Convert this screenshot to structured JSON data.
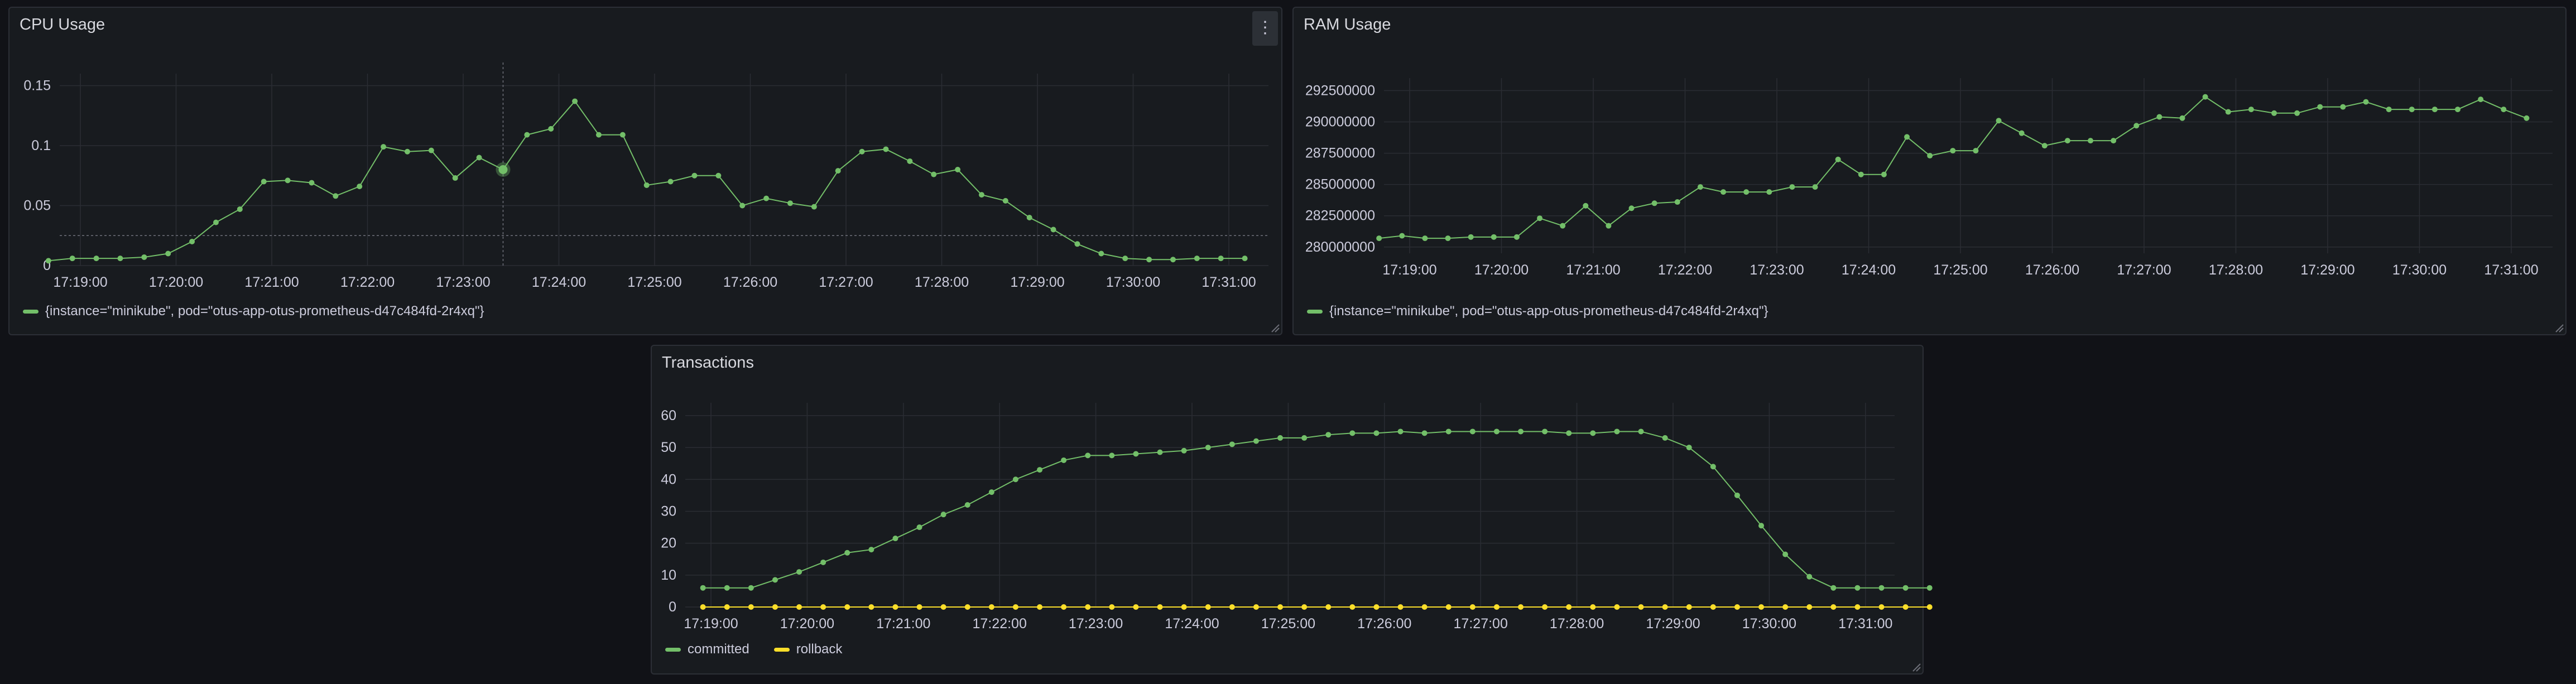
{
  "colors": {
    "series_green": "#73bf69",
    "series_yellow": "#fade2a",
    "grid": "#2a2d33",
    "crosshair": "#6e7079"
  },
  "panels": {
    "cpu": {
      "title": "CPU Usage",
      "menu_icon": "kebab-menu-icon",
      "menu_glyph": "⋮"
    },
    "ram": {
      "title": "RAM Usage"
    },
    "tx": {
      "title": "Transactions"
    }
  },
  "chart_data": [
    {
      "id": "cpu",
      "type": "line",
      "title": "CPU Usage",
      "x_tick_labels": [
        "17:19:00",
        "17:20:00",
        "17:21:00",
        "17:22:00",
        "17:23:00",
        "17:24:00",
        "17:25:00",
        "17:26:00",
        "17:27:00",
        "17:28:00",
        "17:29:00",
        "17:30:00",
        "17:31:00"
      ],
      "y_tick_labels": [
        "0",
        "0.05",
        "0.1",
        "0.15"
      ],
      "ylim": [
        0,
        0.16
      ],
      "x_start": "17:18:40",
      "x_step_seconds": 15,
      "series": [
        {
          "name": "{instance=\"minikube\", pod=\"otus-app-otus-prometheus-d47c484fd-2r4xq\"}",
          "color": "#73bf69",
          "values": [
            0.004,
            0.006,
            0.006,
            0.006,
            0.007,
            0.01,
            0.02,
            0.036,
            0.047,
            0.07,
            0.071,
            0.069,
            0.058,
            0.066,
            0.099,
            0.095,
            0.096,
            0.073,
            0.09,
            0.08,
            0.109,
            0.114,
            0.137,
            0.109,
            0.109,
            0.067,
            0.07,
            0.075,
            0.075,
            0.05,
            0.056,
            0.052,
            0.049,
            0.079,
            0.095,
            0.097,
            0.087,
            0.076,
            0.08,
            0.059,
            0.054,
            0.04,
            0.03,
            0.018,
            0.01,
            0.006,
            0.005,
            0.005,
            0.006,
            0.006,
            0.006
          ]
        }
      ],
      "hover_point_index": 19,
      "legend_placement": "bottom-left",
      "grid": true
    },
    {
      "id": "ram",
      "type": "line",
      "title": "RAM Usage",
      "x_tick_labels": [
        "17:19:00",
        "17:20:00",
        "17:21:00",
        "17:22:00",
        "17:23:00",
        "17:24:00",
        "17:25:00",
        "17:26:00",
        "17:27:00",
        "17:28:00",
        "17:29:00",
        "17:30:00",
        "17:31:00"
      ],
      "y_tick_labels": [
        "280000000",
        "282500000",
        "285000000",
        "287500000",
        "290000000",
        "292500000"
      ],
      "ylim": [
        279500000,
        293500000
      ],
      "x_start": "17:18:40",
      "x_step_seconds": 15,
      "series": [
        {
          "name": "{instance=\"minikube\", pod=\"otus-app-otus-prometheus-d47c484fd-2r4xq\"}",
          "color": "#73bf69",
          "values": [
            280700000,
            280900000,
            280700000,
            280700000,
            280800000,
            280800000,
            280800000,
            282300000,
            281700000,
            283300000,
            281700000,
            283100000,
            283500000,
            283600000,
            284800000,
            284400000,
            284400000,
            284400000,
            284800000,
            284800000,
            287000000,
            285800000,
            285800000,
            288800000,
            287300000,
            287700000,
            287700000,
            290100000,
            289100000,
            288100000,
            288500000,
            288500000,
            288500000,
            289700000,
            290400000,
            290300000,
            292000000,
            290800000,
            291000000,
            290700000,
            290700000,
            291200000,
            291200000,
            291600000,
            291000000,
            291000000,
            291000000,
            291000000,
            291800000,
            291000000,
            290300000
          ]
        }
      ],
      "legend_placement": "bottom-left",
      "grid": true
    },
    {
      "id": "tx",
      "type": "line",
      "title": "Transactions",
      "x_tick_labels": [
        "17:19:00",
        "17:20:00",
        "17:21:00",
        "17:22:00",
        "17:23:00",
        "17:24:00",
        "17:25:00",
        "17:26:00",
        "17:27:00",
        "17:28:00",
        "17:29:00",
        "17:30:00",
        "17:31:00"
      ],
      "y_tick_labels": [
        "0",
        "10",
        "20",
        "30",
        "40",
        "50",
        "60"
      ],
      "ylim": [
        0,
        64
      ],
      "x_start": "17:18:55",
      "x_step_seconds": 15,
      "series": [
        {
          "name": "committed",
          "color": "#73bf69",
          "values": [
            6,
            6,
            6,
            8.5,
            11,
            14,
            17,
            18,
            21.5,
            25,
            29,
            32,
            36,
            40,
            43,
            46,
            47.5,
            47.5,
            48,
            48.5,
            49,
            50,
            51,
            52,
            53,
            53,
            54,
            54.5,
            54.5,
            55,
            54.5,
            55,
            55,
            55,
            55,
            55,
            54.5,
            54.5,
            55,
            55,
            53,
            50,
            44,
            35,
            25.5,
            16.5,
            9.5,
            6,
            6,
            6,
            6,
            6
          ]
        },
        {
          "name": "rollback",
          "color": "#fade2a",
          "values": [
            0,
            0,
            0,
            0,
            0,
            0,
            0,
            0,
            0,
            0,
            0,
            0,
            0,
            0,
            0,
            0,
            0,
            0,
            0,
            0,
            0,
            0,
            0,
            0,
            0,
            0,
            0,
            0,
            0,
            0,
            0,
            0,
            0,
            0,
            0,
            0,
            0,
            0,
            0,
            0,
            0,
            0,
            0,
            0,
            0,
            0,
            0,
            0,
            0,
            0,
            0,
            0
          ]
        }
      ],
      "legend_placement": "bottom-left",
      "grid": true
    }
  ]
}
